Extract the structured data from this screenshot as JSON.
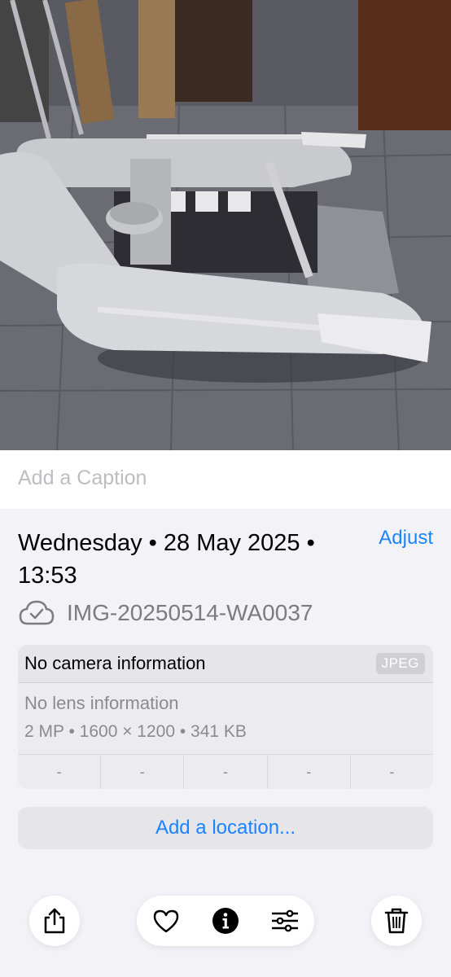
{
  "photo": {
    "subject": "inflatable-dinghy-photo"
  },
  "caption": {
    "placeholder": "Add a Caption"
  },
  "info": {
    "date_line": "Wednesday • 28 May 2025 • 13:53",
    "adjust_label": "Adjust",
    "file_name": "IMG-20250514-WA0037",
    "camera": "No camera information",
    "format_badge": "JPEG",
    "lens": "No lens information",
    "specs": "2 MP • 1600 × 1200 • 341 KB",
    "exif_cells": [
      "-",
      "-",
      "-",
      "-",
      "-"
    ],
    "location_label": "Add a location..."
  },
  "toolbar": {
    "icons": [
      "share-icon",
      "heart-icon",
      "info-icon",
      "adjustments-icon",
      "trash-icon"
    ]
  },
  "colors": {
    "accent": "#1a84ff",
    "background": "#f2f2f7",
    "secondary_text": "#8a8a8f"
  }
}
